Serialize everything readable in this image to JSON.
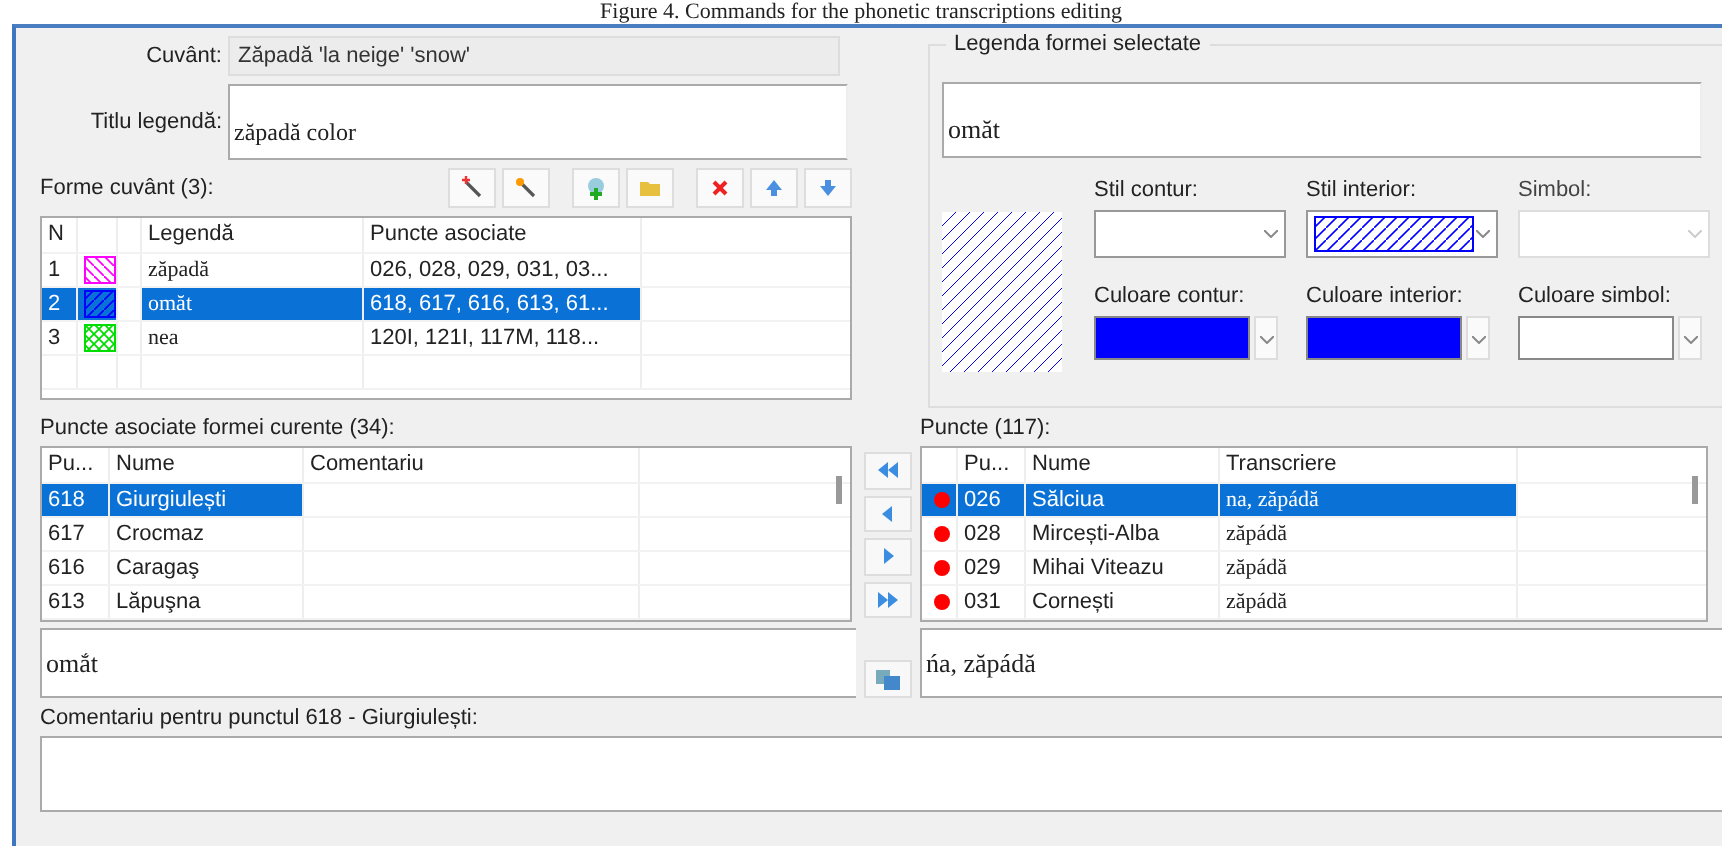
{
  "caption": "Figure 4. Commands for the phonetic transcriptions editing",
  "word": {
    "label": "Cuvânt:",
    "value": "Zăpadă 'la neige' 'snow'"
  },
  "legend_title": {
    "label": "Titlu legendă:",
    "value": "zăpadă color"
  },
  "forms": {
    "label": "Forme cuvânt (3):",
    "columns": [
      "N",
      "Legendă",
      "Puncte asociate"
    ],
    "rows": [
      {
        "n": "1",
        "color": "#ff00ff",
        "kind": "back",
        "legend": "zăpadă",
        "points": "026, 028, 029, 031, 03...",
        "selected": false
      },
      {
        "n": "2",
        "color": "#0000ff",
        "kind": "forward",
        "legend": "omăt",
        "points": "618, 617, 616, 613, 61...",
        "selected": true
      },
      {
        "n": "3",
        "color": "#00dd00",
        "kind": "cross",
        "legend": "nea",
        "points": "120I, 121I, 117M, 118...",
        "selected": false
      }
    ]
  },
  "selected_legend": {
    "title": "Legenda formei selectate",
    "value": "omăt",
    "color": "#0000ff",
    "combos": [
      {
        "label": "Stil contur:",
        "kind": "empty",
        "disabled": false
      },
      {
        "label": "Stil interior:",
        "kind": "hatch",
        "color": "#0000ff",
        "disabled": false
      },
      {
        "label": "Simbol:",
        "kind": "empty",
        "disabled": true
      },
      {
        "label": "Culoare contur:",
        "kind": "color",
        "color": "#0000ff",
        "disabled": false
      },
      {
        "label": "Culoare interior:",
        "kind": "color",
        "color": "#0000ff",
        "disabled": false
      },
      {
        "label": "Culoare simbol:",
        "kind": "color",
        "color": "#ffffff",
        "disabled": false
      }
    ]
  },
  "current_points": {
    "label": "Puncte asociate formei curente (34):",
    "columns": [
      "Pu...",
      "Nume",
      "Comentariu"
    ],
    "rows": [
      {
        "code": "618",
        "name": "Giurgiulești",
        "selected": true
      },
      {
        "code": "617",
        "name": "Crocmaz",
        "selected": false
      },
      {
        "code": "616",
        "name": "Caragaş",
        "selected": false
      },
      {
        "code": "613",
        "name": "Lăpuşna",
        "selected": false
      }
    ],
    "transcription": "omắt"
  },
  "points": {
    "label": "Puncte (117):",
    "columns": [
      "Pu...",
      "Nume",
      "Transcriere"
    ],
    "rows": [
      {
        "code": "026",
        "name": "Sălciua",
        "transcription": "na, zăpádă",
        "color": "#ff0000",
        "selected": true
      },
      {
        "code": "028",
        "name": "Mircești-Alba",
        "transcription": "zăpádă",
        "color": "#ff0000",
        "selected": false
      },
      {
        "code": "029",
        "name": "Mihai Viteazu",
        "transcription": "zăpádă",
        "color": "#ff0000",
        "selected": false
      },
      {
        "code": "031",
        "name": "Cornești",
        "transcription": "zăpádă",
        "color": "#ff0000",
        "selected": false
      }
    ],
    "transcription": "ńa, zăpádă"
  },
  "comment": {
    "label": "Comentariu pentru punctul 618 - Giurgiulești:"
  }
}
